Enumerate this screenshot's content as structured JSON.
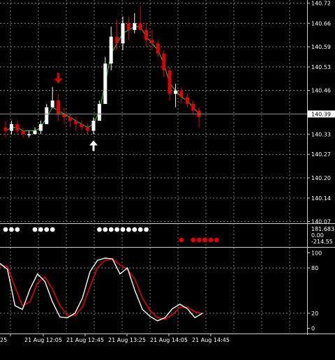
{
  "colors": {
    "background": "#000000",
    "grid": "#9a9a9a",
    "bull": "#ffffff",
    "bear": "#e00000",
    "line_fast": "#ffffff",
    "line_slow": "#e00000",
    "ma": "#33cc33",
    "price_line": "#8a8a8a",
    "price_label_bg": "#ffffff"
  },
  "current_price": "140.39",
  "chart_data": {
    "type": "candlestick",
    "main": {
      "y_ticks": [
        "140.72",
        "140.66",
        "140.59",
        "140.53",
        "140.46",
        "140.39",
        "140.33",
        "140.27",
        "140.20",
        "140.14",
        "140.07"
      ],
      "ylim": [
        140.065,
        140.725
      ],
      "candles": [
        [
          140.35,
          140.37,
          140.32,
          140.34
        ],
        [
          140.34,
          140.37,
          140.33,
          140.36
        ],
        [
          140.36,
          140.37,
          140.33,
          140.34
        ],
        [
          140.34,
          140.35,
          140.32,
          140.33
        ],
        [
          140.33,
          140.34,
          140.32,
          140.33
        ],
        [
          140.33,
          140.35,
          140.33,
          140.34
        ],
        [
          140.34,
          140.37,
          140.33,
          140.36
        ],
        [
          140.36,
          140.42,
          140.36,
          140.41
        ],
        [
          140.41,
          140.47,
          140.41,
          140.43
        ],
        [
          140.43,
          140.45,
          140.37,
          140.39
        ],
        [
          140.39,
          140.41,
          140.36,
          140.38
        ],
        [
          140.38,
          140.39,
          140.35,
          140.37
        ],
        [
          140.37,
          140.38,
          140.34,
          140.36
        ],
        [
          140.36,
          140.37,
          140.34,
          140.35
        ],
        [
          140.35,
          140.36,
          140.33,
          140.34
        ],
        [
          140.34,
          140.38,
          140.33,
          140.37
        ],
        [
          140.37,
          140.43,
          140.37,
          140.42
        ],
        [
          140.42,
          140.56,
          140.42,
          140.54
        ],
        [
          140.54,
          140.65,
          140.52,
          140.62
        ],
        [
          140.62,
          140.67,
          140.58,
          140.6
        ],
        [
          140.6,
          140.68,
          140.58,
          140.66
        ],
        [
          140.66,
          140.68,
          140.61,
          140.64
        ],
        [
          140.64,
          140.69,
          140.63,
          140.66
        ],
        [
          140.66,
          140.71,
          140.65,
          140.64
        ],
        [
          140.64,
          140.66,
          140.59,
          140.61
        ],
        [
          140.61,
          140.64,
          140.58,
          140.6
        ],
        [
          140.6,
          140.61,
          140.56,
          140.57
        ],
        [
          140.57,
          140.58,
          140.5,
          140.52
        ],
        [
          140.52,
          140.53,
          140.43,
          140.45
        ],
        [
          140.45,
          140.48,
          140.41,
          140.46
        ],
        [
          140.46,
          140.47,
          140.42,
          140.44
        ],
        [
          140.44,
          140.45,
          140.41,
          140.42
        ],
        [
          140.42,
          140.43,
          140.39,
          140.4
        ],
        [
          140.4,
          140.41,
          140.35,
          140.38
        ]
      ],
      "ma": [
        140.34,
        140.35,
        140.35,
        140.34,
        140.34,
        140.34,
        140.35,
        140.38,
        140.41,
        140.4,
        140.39,
        140.38,
        140.37,
        140.36,
        140.35,
        140.36,
        140.4,
        140.48,
        140.57,
        140.6,
        140.63,
        140.64,
        140.65,
        140.65,
        140.62,
        140.6,
        140.58,
        140.54,
        140.48,
        140.46,
        140.44,
        140.43,
        140.41,
        140.39
      ],
      "sell_arrows_at": [
        9,
        23
      ],
      "buy_arrows_at": [
        15
      ]
    },
    "dots_panel": {
      "y_ticks": [
        "181.683",
        "0.00",
        "-214.55"
      ],
      "white_dots_at": [
        0,
        1,
        2,
        5,
        6,
        7,
        8,
        16,
        17,
        18,
        19,
        20,
        21,
        22,
        23,
        24
      ],
      "red_dots_at": [
        30,
        32,
        33,
        34,
        35,
        36
      ]
    },
    "stochastic": {
      "y_ticks": [
        "100",
        "80",
        "20",
        "0"
      ],
      "ylim": [
        -5,
        105
      ],
      "fast": [
        86,
        78,
        30,
        25,
        52,
        72,
        62,
        35,
        15,
        14,
        20,
        40,
        75,
        90,
        93,
        92,
        72,
        80,
        50,
        25,
        16,
        10,
        14,
        26,
        32,
        26,
        14,
        20
      ],
      "slow": [
        84,
        82,
        55,
        30,
        35,
        60,
        68,
        52,
        30,
        17,
        17,
        28,
        55,
        80,
        90,
        92,
        84,
        78,
        65,
        40,
        24,
        14,
        12,
        18,
        28,
        28,
        22,
        20
      ]
    },
    "x_ticks": [
      "25",
      "21 Aug 12:05",
      "21 Aug 12:45",
      "21 Aug 13:25",
      "21 Aug 14:05",
      "21 Aug 14:45"
    ]
  }
}
